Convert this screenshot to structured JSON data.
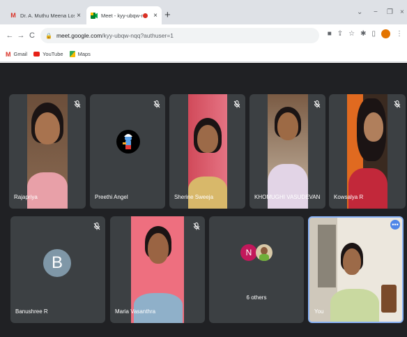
{
  "browser": {
    "tabs": [
      {
        "title": "Dr. A. Muthu Meena Losini is in",
        "favicon": "gmail-icon",
        "active": false
      },
      {
        "title": "Meet - kyy-ubqw-nqq",
        "favicon": "meet-icon",
        "active": true,
        "recording": true
      }
    ],
    "url_host": "meet.google.com",
    "url_path": "/kyy-ubqw-nqq?authuser=1",
    "bookmarks": [
      {
        "label": "Gmail",
        "icon": "gmail-icon"
      },
      {
        "label": "YouTube",
        "icon": "youtube-icon"
      },
      {
        "label": "Maps",
        "icon": "maps-icon"
      }
    ]
  },
  "meet": {
    "row1": [
      {
        "name": "Rajapriya",
        "muted": true
      },
      {
        "name": "Preethi Angel",
        "muted": true
      },
      {
        "name": "Sherine Sweeja",
        "muted": true
      },
      {
        "name": "KHOMUGHI VASUDEVAN",
        "muted": true
      },
      {
        "name": "Kowsalya R",
        "muted": true
      }
    ],
    "row2": [
      {
        "name": "Banushree R",
        "muted": true,
        "initial": "B"
      },
      {
        "name": "Maria Vasanthra",
        "muted": true
      },
      {
        "name": "6 others",
        "initial": "N"
      },
      {
        "name": "You"
      }
    ]
  },
  "colors": {
    "stage_bg": "#202124",
    "tile_bg": "#3c4043",
    "avatar_b": "#7f97a7",
    "avatar_n": "#c2185b",
    "self_border": "#8ab4f8"
  }
}
